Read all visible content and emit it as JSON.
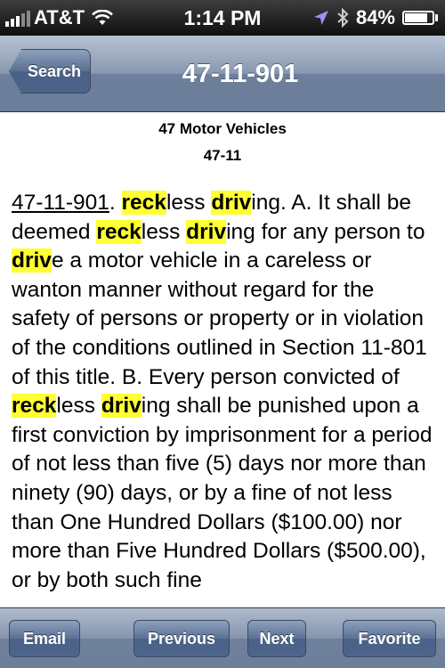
{
  "status_bar": {
    "carrier": "AT&T",
    "time": "1:14 PM",
    "battery": "84%",
    "battery_level": 0.84,
    "icons": [
      "signal-icon",
      "wifi-icon",
      "location-arrow-icon",
      "bluetooth-icon",
      "battery-icon"
    ]
  },
  "nav": {
    "back_label": "Search",
    "title": "47-11-901"
  },
  "content": {
    "heading_line1": "47 Motor Vehicles",
    "heading_line2": "47-11",
    "segments": [
      {
        "t": "47-11-901",
        "s": "u"
      },
      {
        "t": ". ",
        "s": ""
      },
      {
        "t": "reck",
        "s": "hl"
      },
      {
        "t": "less ",
        "s": ""
      },
      {
        "t": "driv",
        "s": "hl"
      },
      {
        "t": "ing. A. It shall be deemed ",
        "s": ""
      },
      {
        "t": "reck",
        "s": "hl"
      },
      {
        "t": "less ",
        "s": ""
      },
      {
        "t": "driv",
        "s": "hl"
      },
      {
        "t": "ing for any person to ",
        "s": ""
      },
      {
        "t": "driv",
        "s": "hl"
      },
      {
        "t": "e a motor vehicle in a careless or wanton manner without regard for the safety of persons or property or in violation of the conditions outlined in Section 11-801 of this title. B. Every person convicted of ",
        "s": ""
      },
      {
        "t": "reck",
        "s": "hl"
      },
      {
        "t": "less ",
        "s": ""
      },
      {
        "t": "driv",
        "s": "hl"
      },
      {
        "t": "ing shall be punished upon a first conviction by imprisonment for a period of not less than five (5) days nor more than ninety (90) days, or by a fine of not less than One Hundred Dollars ($100.00) nor more than Five Hundred Dollars ($500.00), or by both such fine",
        "s": ""
      }
    ]
  },
  "toolbar": {
    "email_label": "Email",
    "previous_label": "Previous",
    "next_label": "Next",
    "favorite_label": "Favorite"
  },
  "colors": {
    "highlight": "#ffff33",
    "nav_bar": "#8898b0",
    "button": "#4b6288"
  }
}
